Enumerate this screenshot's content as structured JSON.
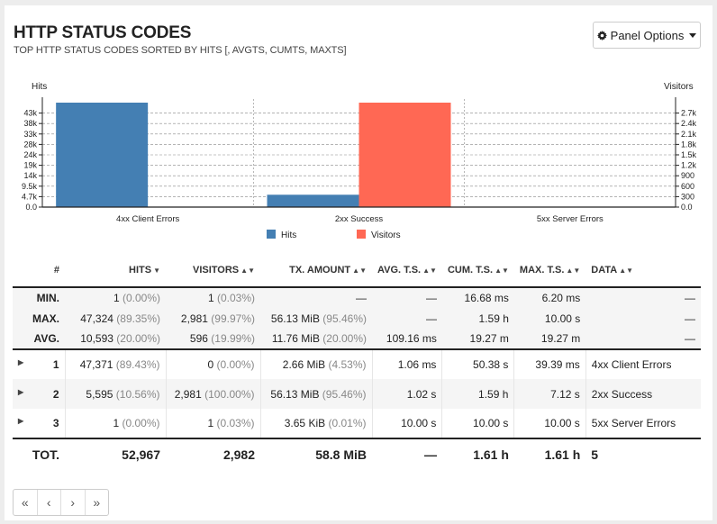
{
  "header": {
    "title": "HTTP STATUS CODES",
    "subtitle": "TOP HTTP STATUS CODES SORTED BY HITS [, AVGTS, CUMTS, MAXTS]",
    "panel_options_label": "Panel Options"
  },
  "chart_data": {
    "type": "bar",
    "categories": [
      "4xx Client Errors",
      "2xx Success",
      "5xx Server Errors"
    ],
    "series": [
      {
        "name": "Hits",
        "values": [
          47371,
          5595,
          1
        ],
        "color": "#447fb3"
      },
      {
        "name": "Visitors",
        "values": [
          0,
          2981,
          1
        ],
        "color": "#ff6854"
      }
    ],
    "y_left_label": "Hits",
    "y_right_label": "Visitors",
    "y_left_ticks": [
      "0.0",
      "4.7k",
      "9.5k",
      "14k",
      "19k",
      "24k",
      "28k",
      "33k",
      "38k",
      "43k"
    ],
    "y_left_tick_values": [
      0,
      4737,
      9474,
      14211,
      18948,
      23686,
      28423,
      33160,
      37897,
      42634
    ],
    "y_right_ticks": [
      "0.0",
      "300",
      "600",
      "900",
      "1.2k",
      "1.5k",
      "1.8k",
      "2.1k",
      "2.4k",
      "2.7k"
    ],
    "y_right_tick_values": [
      0,
      298,
      596,
      894,
      1192,
      1491,
      1789,
      2087,
      2385,
      2683
    ],
    "ylim_left": [
      0,
      47371
    ],
    "ylim_right": [
      0,
      2981
    ],
    "grid": true,
    "legend": "bottom-center"
  },
  "table": {
    "headers": {
      "num": "#",
      "hits": "HITS",
      "visitors": "VISITORS",
      "tx": "TX. AMOUNT",
      "avgts": "AVG. T.S.",
      "cumts": "CUM. T.S.",
      "maxts": "MAX. T.S.",
      "data": "DATA"
    },
    "sort_icons": {
      "desc": "▼",
      "both": "▲▼"
    },
    "meta": [
      {
        "label": "MIN.",
        "hits": "1",
        "hits_pct": "(0.00%)",
        "visitors": "1",
        "visitors_pct": "(0.03%)",
        "tx": "—",
        "tx_pct": "",
        "avgts": "—",
        "cumts": "16.68 ms",
        "maxts": "6.20 ms",
        "data": "—"
      },
      {
        "label": "MAX.",
        "hits": "47,324",
        "hits_pct": "(89.35%)",
        "visitors": "2,981",
        "visitors_pct": "(99.97%)",
        "tx": "56.13 MiB",
        "tx_pct": "(95.46%)",
        "avgts": "—",
        "cumts": "1.59 h",
        "maxts": "10.00 s",
        "data": "—"
      },
      {
        "label": "AVG.",
        "hits": "10,593",
        "hits_pct": "(20.00%)",
        "visitors": "596",
        "visitors_pct": "(19.99%)",
        "tx": "11.76 MiB",
        "tx_pct": "(20.00%)",
        "avgts": "109.16 ms",
        "cumts": "19.27 m",
        "maxts": "19.27 m",
        "data": "—"
      }
    ],
    "rows": [
      {
        "num": "1",
        "hits": "47,371",
        "hits_pct": "(89.43%)",
        "visitors": "0",
        "visitors_pct": "(0.00%)",
        "tx": "2.66 MiB",
        "tx_pct": "(4.53%)",
        "avgts": "1.06 ms",
        "cumts": "50.38 s",
        "maxts": "39.39 ms",
        "data": "4xx Client Errors"
      },
      {
        "num": "2",
        "hits": "5,595",
        "hits_pct": "(10.56%)",
        "visitors": "2,981",
        "visitors_pct": "(100.00%)",
        "tx": "56.13 MiB",
        "tx_pct": "(95.46%)",
        "avgts": "1.02 s",
        "cumts": "1.59 h",
        "maxts": "7.12 s",
        "data": "2xx Success"
      },
      {
        "num": "3",
        "hits": "1",
        "hits_pct": "(0.00%)",
        "visitors": "1",
        "visitors_pct": "(0.03%)",
        "tx": "3.65 KiB",
        "tx_pct": "(0.01%)",
        "avgts": "10.00 s",
        "cumts": "10.00 s",
        "maxts": "10.00 s",
        "data": "5xx Server Errors"
      }
    ],
    "expand_icon": "▶",
    "total": {
      "label": "TOT.",
      "hits": "52,967",
      "visitors": "2,982",
      "tx": "58.8 MiB",
      "avgts": "—",
      "cumts": "1.61 h",
      "maxts": "1.61 h",
      "data": "5"
    }
  },
  "pager": {
    "first": "«",
    "prev": "‹",
    "next": "›",
    "last": "»"
  }
}
